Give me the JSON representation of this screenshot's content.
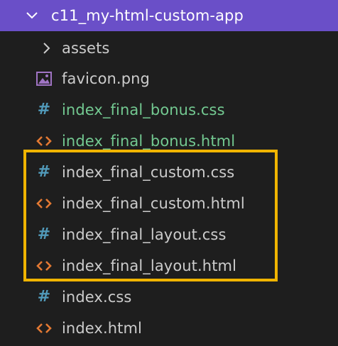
{
  "folder": {
    "name": "c11_my-html-custom-app",
    "expanded_icon": "chevron-down-icon"
  },
  "items": [
    {
      "name": "assets",
      "kind": "folder",
      "icon": "chevron-right-icon",
      "status": "normal"
    },
    {
      "name": "favicon.png",
      "kind": "image",
      "icon": "image-file-icon",
      "status": "normal"
    },
    {
      "name": "index_final_bonus.css",
      "kind": "css",
      "icon": "css-hash-icon",
      "status": "modified"
    },
    {
      "name": "index_final_bonus.html",
      "kind": "html",
      "icon": "html-code-icon",
      "status": "modified"
    },
    {
      "name": "index_final_custom.css",
      "kind": "css",
      "icon": "css-hash-icon",
      "status": "normal"
    },
    {
      "name": "index_final_custom.html",
      "kind": "html",
      "icon": "html-code-icon",
      "status": "normal"
    },
    {
      "name": "index_final_layout.css",
      "kind": "css",
      "icon": "css-hash-icon",
      "status": "normal"
    },
    {
      "name": "index_final_layout.html",
      "kind": "html",
      "icon": "html-code-icon",
      "status": "normal"
    },
    {
      "name": "index.css",
      "kind": "css",
      "icon": "css-hash-icon",
      "status": "normal"
    },
    {
      "name": "index.html",
      "kind": "html",
      "icon": "html-code-icon",
      "status": "normal"
    }
  ],
  "colors": {
    "background": "#1e1e1e",
    "folder_header": "#6a4fc8",
    "text": "#cccccc",
    "modified_text": "#73c991",
    "css_icon": "#519aba",
    "html_icon": "#e37933",
    "image_icon": "#a074c4",
    "highlight": "#f0b400"
  },
  "highlight": {
    "label": "highlighted-files-box"
  }
}
